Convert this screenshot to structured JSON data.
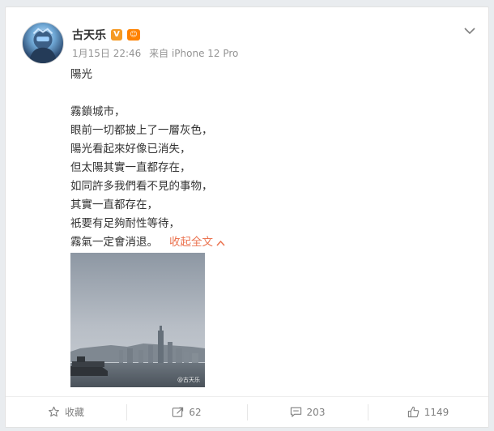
{
  "post": {
    "username": "古天乐",
    "verified_badge": "V",
    "member_badge": "☺",
    "date": "1月15日 22:46",
    "source": "来自 iPhone 12 Pro",
    "title_line": "陽光",
    "lines": [
      "霧鎖城市，",
      "眼前一切都披上了一層灰色，",
      "陽光看起來好像已消失，",
      "但太陽其實一直都存在，",
      "如同許多我們看不見的事物，",
      "其實一直都存在，",
      "衹要有足夠耐性等待，",
      "霧氣一定會消退。"
    ],
    "collapse_label": "收起全文",
    "photo_watermark": "@古天乐"
  },
  "actions": {
    "favorite_label": "收藏",
    "repost_count": "62",
    "comment_count": "203",
    "like_count": "1149"
  },
  "colors": {
    "accent": "#eb7350",
    "vip": "#f59a23"
  },
  "icons": [
    "chevron-down-icon",
    "star-icon",
    "repost-icon",
    "comment-icon",
    "thumbs-up-icon"
  ]
}
